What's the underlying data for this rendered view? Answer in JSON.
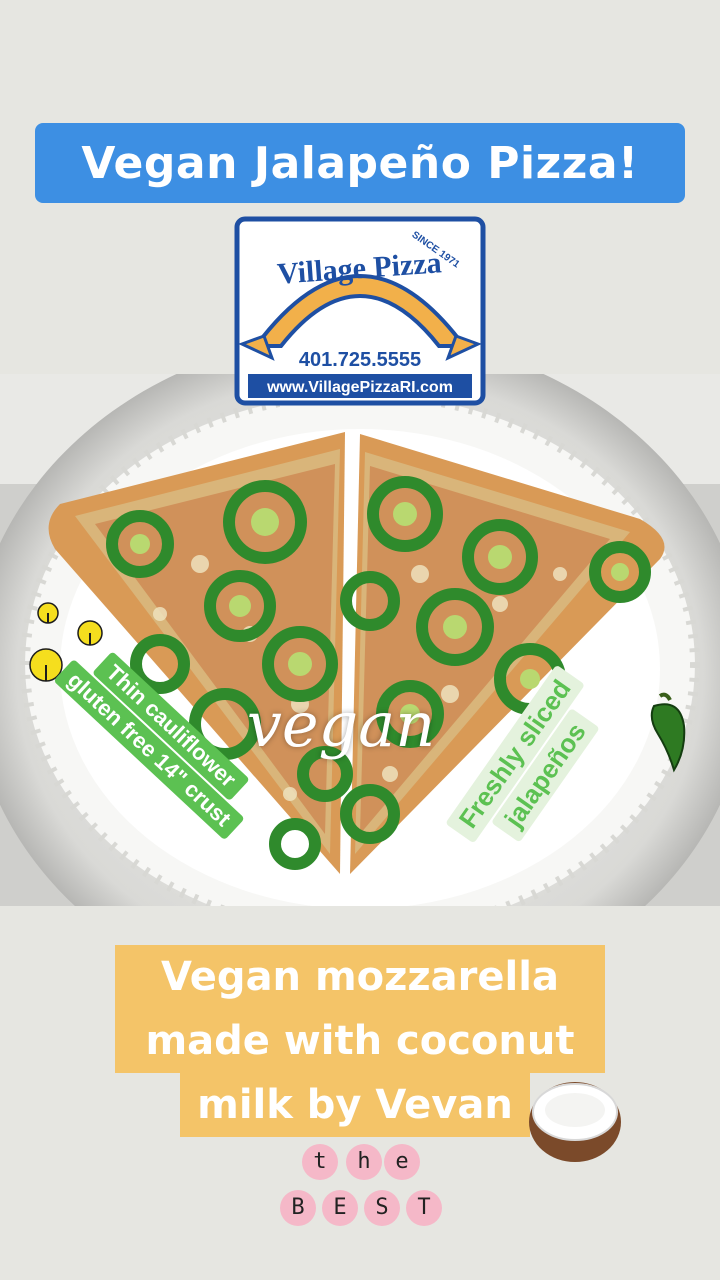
{
  "title": "Vegan Jalapeño Pizza!",
  "logo": {
    "name": "Village Pizza",
    "since": "SINCE 1971",
    "phone": "401.725.5555",
    "website": "www.VillagePizzaRI.com"
  },
  "overlay_word": "vegan",
  "crust_sticker": [
    "Thin cauliflower",
    "gluten free 14\" crust"
  ],
  "jalapeno_sticker": [
    "Freshly sliced",
    "jalapeños"
  ],
  "mozzarella_caption": [
    "Vegan mozzarella",
    "made with coconut",
    "milk by Vevan"
  ],
  "best_sticker": {
    "top": [
      "t",
      "h",
      "e"
    ],
    "bottom": [
      "B",
      "E",
      "S",
      "T"
    ]
  },
  "colors": {
    "background": "#e6e6e1",
    "title_banner": "#3d8fe3",
    "green_sticker": "#5cc152",
    "caption_banner": "#f4c468",
    "best_bubbles": "#f5b8c8"
  },
  "icons": [
    "cauliflower-icon",
    "jalapeno-icon",
    "coconut-icon"
  ]
}
